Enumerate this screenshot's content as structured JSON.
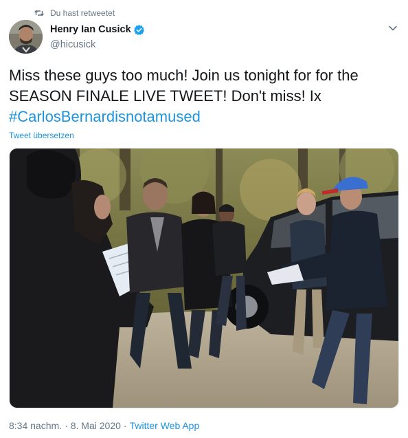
{
  "retweet_context": {
    "icon": "retweet-icon",
    "label": "Du hast retweetet"
  },
  "author": {
    "display_name": "Henry Ian Cusick",
    "handle": "@hicusick",
    "verified_icon": "verified-badge-icon",
    "avatar_icon": "avatar-photo"
  },
  "menu": {
    "icon": "chevron-down-icon"
  },
  "tweet": {
    "text": "Miss these guys too much! Join us tonight for for the SEASON FINALE LIVE TWEET! Don't miss! Ix",
    "hashtag": "#CarlosBernardisnotamused",
    "translate_label": "Tweet übersetzen"
  },
  "media": {
    "icon": "photo"
  },
  "meta": {
    "time": "8:34 nachm.",
    "separator": "·",
    "date": "8. Mai 2020",
    "source": "Twitter Web App"
  },
  "colors": {
    "link": "#1b95e0",
    "muted": "#657786",
    "text": "#14171a",
    "verified": "#1da1f2"
  }
}
